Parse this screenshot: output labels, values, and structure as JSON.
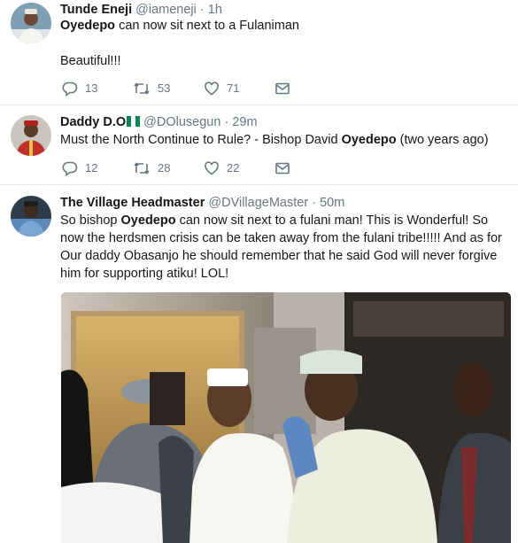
{
  "tweets": [
    {
      "name": "Tunde Eneji",
      "handle": "@iameneji",
      "dot": "·",
      "time": "1h",
      "text_bold": "Oyedepo",
      "text_rest": " can now sit next to a Fulaniman",
      "text_line2": "Beautiful!!!",
      "replies": "13",
      "retweets": "53",
      "likes": "71"
    },
    {
      "name": "Daddy D.O",
      "handle": "@DOlusegun",
      "dot": "·",
      "time": "29m",
      "text_pre": "Must the North Continue to Rule? - Bishop David ",
      "text_bold": "Oyedepo",
      "text_post": " (two years ago)",
      "replies": "12",
      "retweets": "28",
      "likes": "22"
    },
    {
      "name": "The Village Headmaster",
      "handle": "@DVillageMaster",
      "dot": "·",
      "time": "50m",
      "text_pre": "So bishop ",
      "text_bold": "Oyedepo",
      "text_post": " can now sit next to a fulani man! This is Wonderful! So now the herdsmen crisis can be taken away from the fulani tribe!!!!! And as for Our daddy Obasanjo he should remember that he said God will never forgive him for supporting atiku! LOL!"
    }
  ],
  "colors": {
    "text": "#14171a",
    "muted": "#657786",
    "divider": "#e6ecf0",
    "flag_green": "#008751"
  },
  "icons": [
    "reply-icon",
    "retweet-icon",
    "like-icon",
    "dm-icon"
  ]
}
